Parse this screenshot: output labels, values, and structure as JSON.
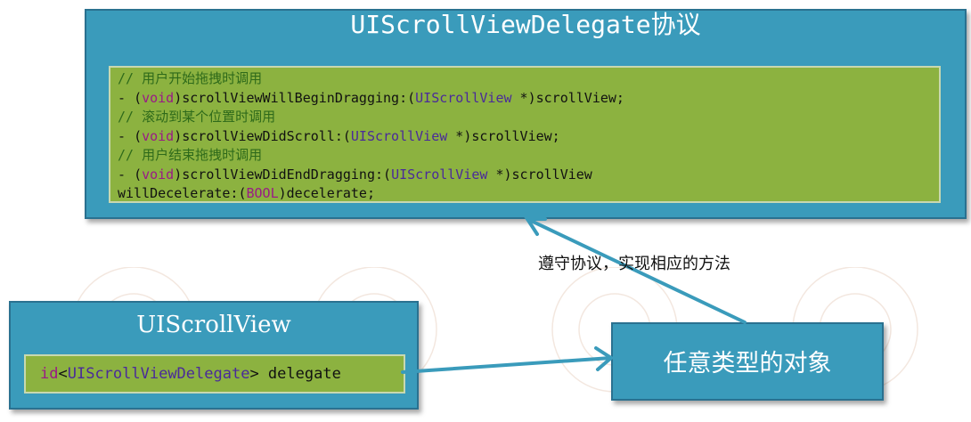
{
  "protocol": {
    "title": "UIScrollViewDelegate协议",
    "comment1": "// 用户开始拖拽时调用",
    "comment2": "// 滚动到某个位置时调用",
    "comment3": "// 用户结束拖拽时调用",
    "dash": "- ",
    "void_kw": "void",
    "type_scrollview": "UIScrollView",
    "type_bool": "BOOL",
    "method1": "scrollViewWillBeginDragging:",
    "method2": "scrollViewDidScroll:",
    "method3": "scrollViewDidEndDragging:",
    "method3_part2": "willDecelerate:",
    "param": " *)scrollView;",
    "param_nosemi": " *)scrollView",
    "param_decelerate": ")decelerate;"
  },
  "scrollview": {
    "title": "UIScrollView",
    "id_kw": "id",
    "protocol_ref": "UIScrollViewDelegate",
    "property": "delegate"
  },
  "object": {
    "label": "任意类型的对象"
  },
  "conform_label": "遵守协议，实现相应的方法",
  "colors": {
    "box_fill": "#3a9bbb",
    "code_fill": "#8cb240",
    "arrow": "#3a9bbb",
    "keyword": "#9a1a86",
    "type": "#4a2a9a",
    "comment": "#2e6a1a"
  }
}
